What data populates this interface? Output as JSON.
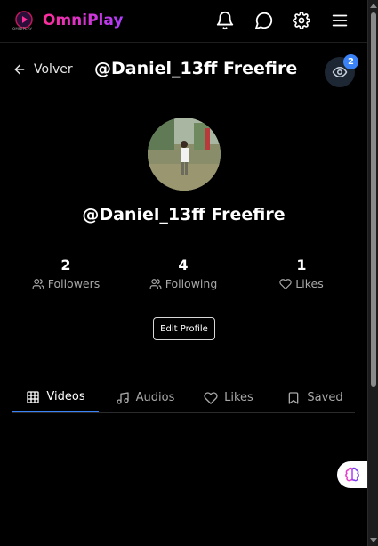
{
  "header": {
    "brand": "OmniPlay",
    "logo_caption": "OMNIPLAY",
    "icons": [
      "bell-icon",
      "chat-icon",
      "settings-icon",
      "menu-icon"
    ]
  },
  "nav": {
    "back_label": "Volver",
    "title": "@Daniel_13ff Freefire",
    "views_badge": "2"
  },
  "profile": {
    "name": "@Daniel_13ff Freefire",
    "stats": [
      {
        "value": "2",
        "label": "Followers",
        "icon": "users-icon"
      },
      {
        "value": "4",
        "label": "Following",
        "icon": "users-icon"
      },
      {
        "value": "1",
        "label": "Likes",
        "icon": "heart-icon"
      }
    ],
    "edit_button": "Edit Profile"
  },
  "tabs": [
    {
      "label": "Videos",
      "icon": "grid-icon",
      "active": true
    },
    {
      "label": "Audios",
      "icon": "music-icon",
      "active": false
    },
    {
      "label": "Likes",
      "icon": "heart-icon",
      "active": false
    },
    {
      "label": "Saved",
      "icon": "bookmark-icon",
      "active": false
    }
  ],
  "colors": {
    "accent": "#3b82f6",
    "brand_gradient_start": "#ff2d9a",
    "brand_gradient_end": "#b03cff",
    "background": "#000000"
  }
}
